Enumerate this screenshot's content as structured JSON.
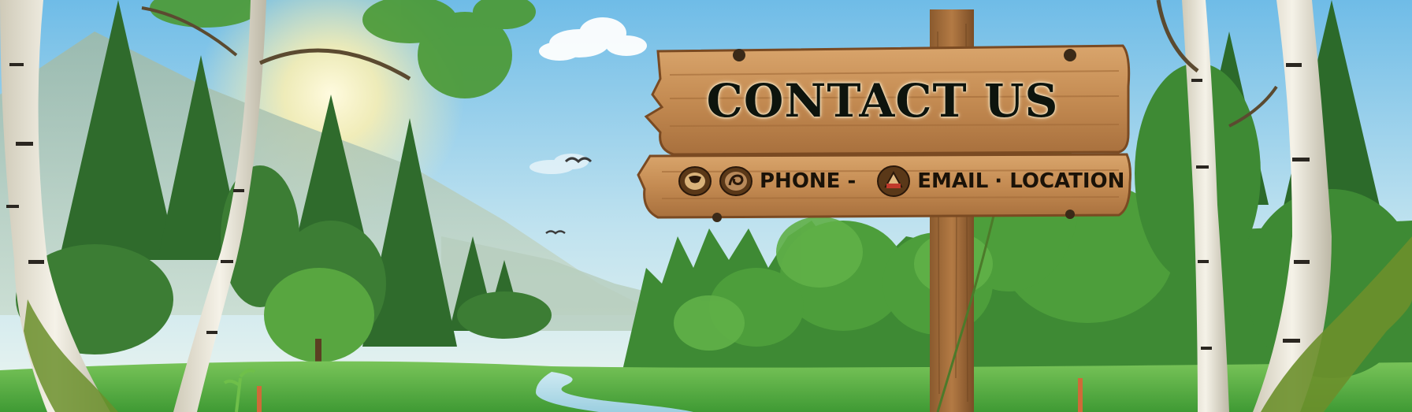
{
  "sign": {
    "title": "CONTACT US",
    "items": [
      {
        "label": "PHONE -",
        "icon": "phone-icon"
      },
      {
        "label": "EMAIL",
        "icon": "email-icon"
      },
      {
        "label": "· LOCATION",
        "icon": "location-icon"
      }
    ]
  },
  "colors": {
    "sky_top": "#7ec3ea",
    "sky_bottom": "#e3f2f4",
    "grass": "#5bb043",
    "forest_dark": "#2b6a2a",
    "wood": "#c8925a",
    "wood_dark": "#8a5a2e",
    "text": "#0d140d"
  }
}
